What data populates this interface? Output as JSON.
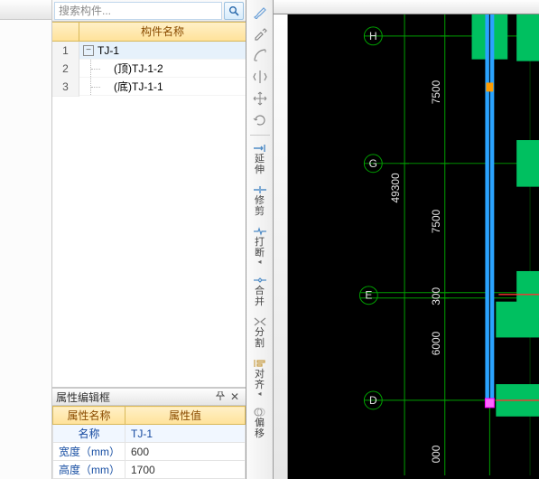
{
  "search": {
    "placeholder": "搜索构件..."
  },
  "treeHeader": {
    "title": "构件名称"
  },
  "treeRows": [
    {
      "num": "1",
      "label": "TJ-1",
      "expanded": true,
      "selected": true
    },
    {
      "num": "2",
      "label": "(顶)TJ-1-2"
    },
    {
      "num": "3",
      "label": "(底)TJ-1-1"
    }
  ],
  "propPanel": {
    "title": "属性编辑框",
    "headKey": "属性名称",
    "headVal": "属性值",
    "rows": [
      {
        "key": "名称",
        "val": "TJ-1",
        "hi": true
      },
      {
        "key": "宽度（mm）",
        "val": "600"
      },
      {
        "key": "高度（mm）",
        "val": "1700"
      }
    ]
  },
  "tools": {
    "yan": "延",
    "shen": "伸",
    "xiu": "修",
    "jian": "剪",
    "da": "打",
    "duan": "断",
    "he": "合",
    "bing": "并",
    "fen": "分",
    "ge": "割",
    "dui": "对",
    "qi": "齐",
    "pian": "偏",
    "yi": "移"
  },
  "cad": {
    "grids": {
      "H": "H",
      "G": "G",
      "E": "E",
      "D": "D"
    },
    "dims": {
      "d49300": "49300",
      "d7500a": "7500",
      "d7500b": "7500",
      "d300": "300",
      "d6000": "6000",
      "d000": "000"
    },
    "colors": {
      "grid": "#00a000",
      "block": "#00c060",
      "beam": "#2aa3ff",
      "hilite": "#ff00ff",
      "leader": "#ff3030",
      "marker": "#ff9c00"
    }
  }
}
